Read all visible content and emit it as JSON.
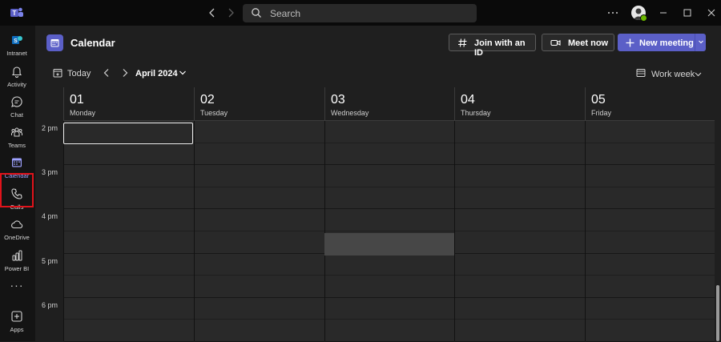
{
  "titlebar": {
    "search_placeholder": "Search",
    "more_label": "···"
  },
  "rail": {
    "items": [
      {
        "label": "Intranet",
        "icon": "intranet-icon"
      },
      {
        "label": "Activity",
        "icon": "bell-icon"
      },
      {
        "label": "Chat",
        "icon": "chat-icon"
      },
      {
        "label": "Teams",
        "icon": "teams-icon"
      },
      {
        "label": "Calendar",
        "icon": "calendar-icon",
        "active": true
      },
      {
        "label": "Calls",
        "icon": "phone-icon"
      },
      {
        "label": "OneDrive",
        "icon": "cloud-icon"
      },
      {
        "label": "Power BI",
        "icon": "power-bi-icon"
      },
      {
        "label": "Apps",
        "icon": "apps-icon"
      }
    ],
    "more_label": "···"
  },
  "header": {
    "title": "Calendar",
    "join_label": "Join with an ID",
    "meet_label": "Meet now",
    "new_meeting_label": "New meeting"
  },
  "toolbar": {
    "today_label": "Today",
    "month_label": "April 2024",
    "view_label": "Work week"
  },
  "days": [
    {
      "num": "01",
      "name": "Monday"
    },
    {
      "num": "02",
      "name": "Tuesday"
    },
    {
      "num": "03",
      "name": "Wednesday"
    },
    {
      "num": "04",
      "name": "Thursday"
    },
    {
      "num": "05",
      "name": "Friday"
    }
  ],
  "times": [
    "2 pm",
    "3 pm",
    "4 pm",
    "5 pm",
    "6 pm"
  ],
  "colors": {
    "accent": "#5b5fc7",
    "active_rail": "#9ea2ff",
    "highlight_border": "#e0131b",
    "presence": "#6bb700"
  }
}
